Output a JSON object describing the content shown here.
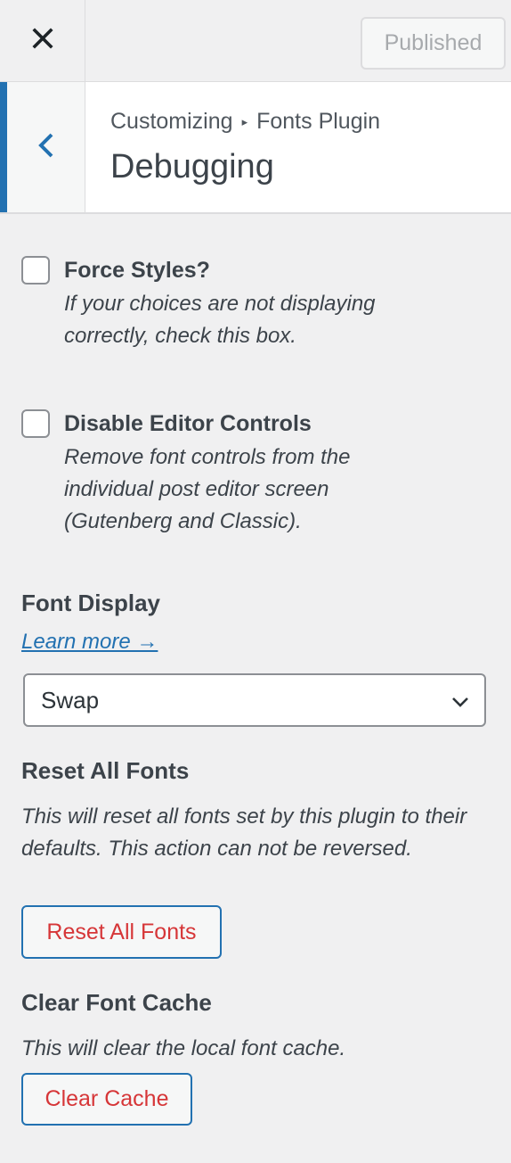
{
  "header": {
    "close_icon": "close-icon",
    "publish_label": "Published"
  },
  "section": {
    "back_icon": "chevron-left-icon",
    "breadcrumb_root": "Customizing",
    "breadcrumb_sep": "▸",
    "breadcrumb_parent": "Fonts Plugin",
    "title": "Debugging"
  },
  "controls": {
    "force_styles": {
      "label": "Force Styles?",
      "description": "If your choices are not displaying correctly, check this box.",
      "checked": false
    },
    "disable_editor": {
      "label": "Disable Editor Controls",
      "description": "Remove font controls from the individual post editor screen (Gutenberg and Classic).",
      "checked": false
    },
    "font_display": {
      "title": "Font Display",
      "learn_more": "Learn more →",
      "selected": "Swap"
    },
    "reset": {
      "title": "Reset All Fonts",
      "description": "This will reset all fonts set by this plugin to their defaults. This action can not be reversed.",
      "button": "Reset All Fonts"
    },
    "cache": {
      "title": "Clear Font Cache",
      "description": "This will clear the local font cache.",
      "button": "Clear Cache"
    }
  },
  "colors": {
    "accent": "#2271b1",
    "danger": "#d63638",
    "background": "#f0f0f1"
  }
}
